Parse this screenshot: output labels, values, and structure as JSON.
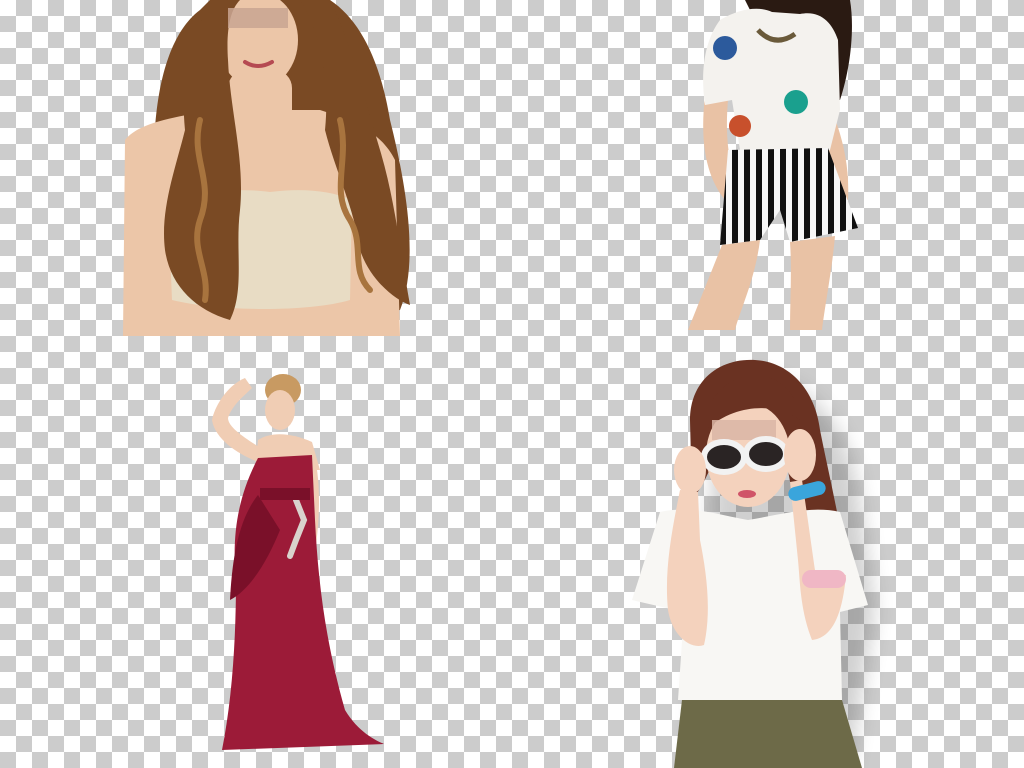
{
  "canvas": {
    "background": "transparency-checkerboard",
    "checker_light": "#ffffff",
    "checker_dark": "#cccccc"
  },
  "figures": [
    {
      "label": "woman-long-curly-hair-crop-top",
      "skin": "#ecc6a8",
      "hair": "#7a4a24",
      "hair_highlight": "#a8743e",
      "top": "#e8dcc4"
    },
    {
      "label": "woman-tee-striped-shorts",
      "skin": "#e9c2a5",
      "hair": "#2a1a12",
      "top": "#f4f2ee",
      "print": [
        "#2c5a9c",
        "#1aa08e",
        "#c8502c"
      ],
      "shorts_stripe_dark": "#111111",
      "shorts_stripe_light": "#f7f7f7"
    },
    {
      "label": "woman-red-evening-gown",
      "skin": "#f0cdb4",
      "hair": "#c89a62",
      "gown": "#9c1b38",
      "gown_shade": "#7a1029"
    },
    {
      "label": "woman-sunglasses-white-top",
      "skin": "#f4d2bd",
      "hair": "#6a3222",
      "top": "#f8f7f4",
      "skirt": "#6d6a48",
      "sunglasses_frame": "#f2f2f2",
      "bracelet_blue": "#3aa5dc",
      "bracelet_pink": "#f0b7c5"
    }
  ]
}
